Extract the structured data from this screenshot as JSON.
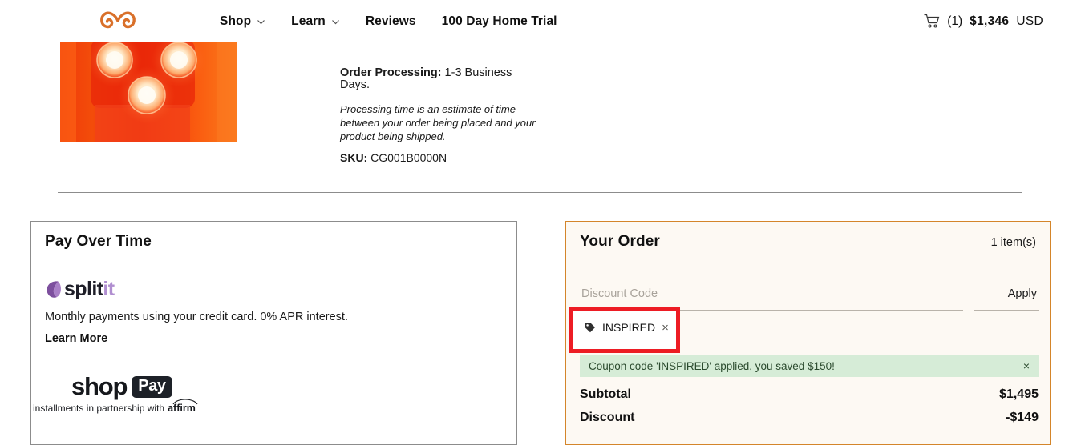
{
  "header": {
    "logo_icon": "infinity-spiral-logo",
    "logo_color": "#d9702a",
    "nav": [
      {
        "label": "Shop",
        "has_dropdown": true
      },
      {
        "label": "Learn",
        "has_dropdown": true
      },
      {
        "label": "Reviews",
        "has_dropdown": false
      },
      {
        "label": "100 Day Home Trial",
        "has_dropdown": false
      }
    ],
    "cart": {
      "icon": "shopping-cart-icon",
      "count": "(1)",
      "amount": "$1,346",
      "currency": "USD"
    }
  },
  "product": {
    "image_alt": "red-sauna-with-three-lamps",
    "order_processing_label": "Order Processing:",
    "order_processing_value": "1-3 Business Days.",
    "processing_note": "Processing time is an estimate of time between your order being placed and your product being shipped.",
    "sku_label": "SKU:",
    "sku_value": "CG001B0000N"
  },
  "pay_over_time": {
    "title": "Pay Over Time",
    "splitit": {
      "logo_icon": "splitit-leaf-icon",
      "word_dark": "split",
      "word_light": "it",
      "accent_color": "#b08ed0"
    },
    "description": "Monthly payments using your credit card. 0% APR interest.",
    "learn_more": "Learn More",
    "shop_pay": {
      "word": "shop",
      "badge": "Pay",
      "footnote": "installments in partnership with",
      "partner": "affirm"
    }
  },
  "order": {
    "title": "Your Order",
    "item_count": "1 item(s)",
    "discount_placeholder": "Discount Code",
    "discount_value": "",
    "apply_label": "Apply",
    "applied_coupon": {
      "icon": "price-tag-icon",
      "code": "INSPIRED",
      "remove": "×",
      "highlight_color": "#ed1c24"
    },
    "alert": {
      "message": "Coupon code 'INSPIRED' applied, you saved $150!",
      "close": "×",
      "background": "#d6ecd7"
    },
    "summary": [
      {
        "label": "Subtotal",
        "value": "$1,495"
      },
      {
        "label": "Discount",
        "value": "-$149"
      }
    ],
    "border_color": "#d4852a",
    "background": "#fdf9f3"
  }
}
